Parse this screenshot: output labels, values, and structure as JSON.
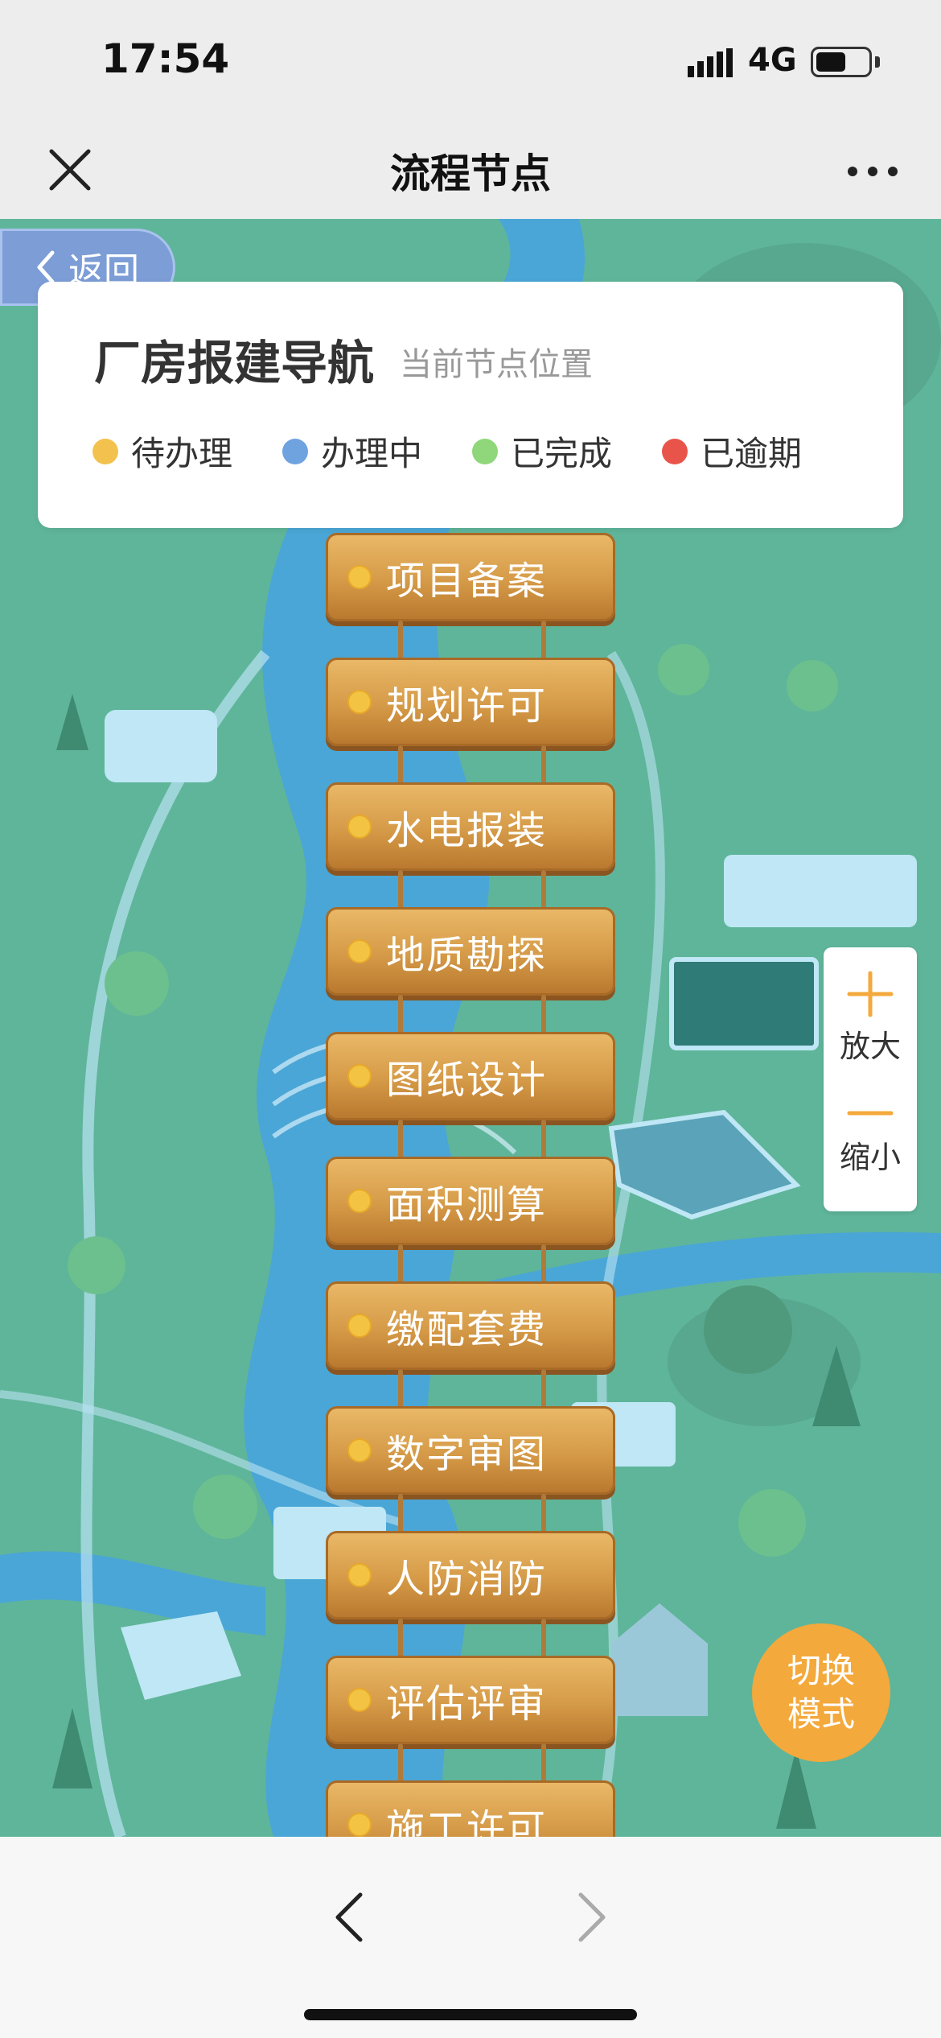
{
  "status_bar": {
    "time": "17:54",
    "network": "4G"
  },
  "nav_bar": {
    "title": "流程节点",
    "close_icon": "close-icon",
    "more_icon": "more-icon"
  },
  "back_button": {
    "label": "返回"
  },
  "header_card": {
    "title": "厂房报建导航",
    "subtitle": "当前节点位置",
    "legend": [
      {
        "label": "待办理",
        "color": "#f2c14e"
      },
      {
        "label": "办理中",
        "color": "#6fa3e0"
      },
      {
        "label": "已完成",
        "color": "#8fd77a"
      },
      {
        "label": "已逾期",
        "color": "#e9544a"
      }
    ]
  },
  "nodes": [
    {
      "label": "项目备案"
    },
    {
      "label": "规划许可"
    },
    {
      "label": "水电报装"
    },
    {
      "label": "地质勘探"
    },
    {
      "label": "图纸设计"
    },
    {
      "label": "面积测算"
    },
    {
      "label": "缴配套费"
    },
    {
      "label": "数字审图"
    },
    {
      "label": "人防消防"
    },
    {
      "label": "评估评审"
    },
    {
      "label": "施工许可"
    }
  ],
  "zoom": {
    "zoom_in_label": "放大",
    "zoom_out_label": "缩小"
  },
  "switch_mode": {
    "line1": "切换",
    "line2": "模式"
  },
  "colors": {
    "accent": "#f4a93c",
    "map_bg": "#5fb59a",
    "river": "#4aa6d6"
  }
}
